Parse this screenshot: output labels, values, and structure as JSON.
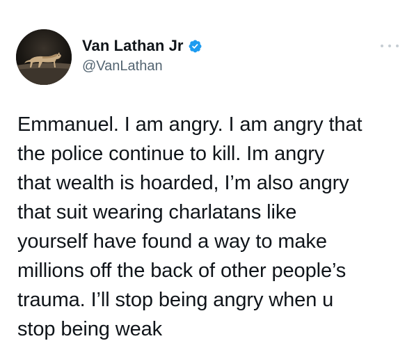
{
  "author": {
    "display_name": "Van Lathan Jr",
    "handle": "@VanLathan",
    "verified": true,
    "avatar_icon": "cougar-avatar-icon",
    "verified_icon": "verified-badge-icon",
    "accent_color": "#1d9bf0"
  },
  "menu": {
    "icon": "more-options-icon"
  },
  "tweet": {
    "text": "Emmanuel. I am angry. I am angry that\nthe police continue to kill. Im angry\nthat wealth is hoarded, I’m also angry\nthat suit wearing charlatans like\nyourself have found a way to make\nmillions off the back of other people’s\ntrauma. I’ll stop being angry when u\nstop being weak"
  }
}
